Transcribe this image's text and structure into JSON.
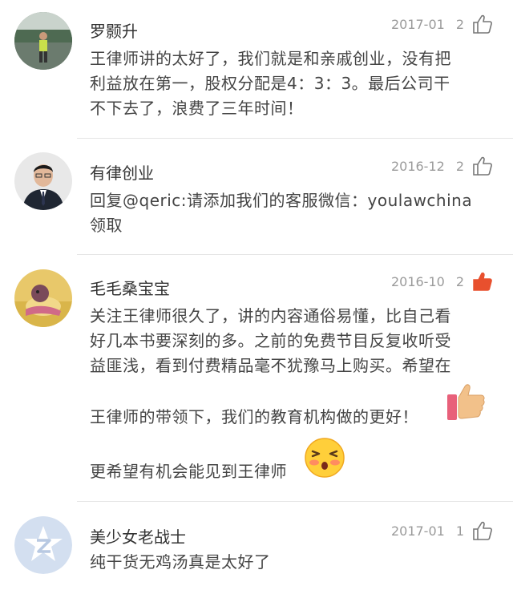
{
  "colors": {
    "liked": "#e8502e",
    "meta": "#9a9a9a",
    "divider": "#e5e5e5"
  },
  "comments": [
    {
      "name": "罗颢升",
      "date": "2017-01",
      "likes": "2",
      "liked": false,
      "avatar": "runner-photo",
      "lines": [
        "王律师讲的太好了，我们就是和亲戚创业，没有把",
        "利益放在第一，股权分配是4：3：3。最后公司干",
        "不下去了，浪费了三年时间！"
      ]
    },
    {
      "name": "有律创业",
      "date": "2016-12",
      "likes": "2",
      "liked": false,
      "avatar": "man-in-suit-photo",
      "lines": [
        "回复@qeric:请添加我们的客服微信：youlawchina",
        "领取"
      ]
    },
    {
      "name": "毛毛桑宝宝",
      "date": "2016-10",
      "likes": "2",
      "liked": true,
      "avatar": "toy-photo",
      "lines": [
        "关注王律师很久了，讲的内容通俗易懂，比自己看",
        "好几本书要深刻的多。之前的免费节目反复收听受",
        "益匪浅，看到付费精品毫不犹豫马上购买。希望在",
        "王律师的带领下，我们的教育机构做的更好！",
        "更希望有机会能见到王律师"
      ],
      "emojis": [
        "thumbs-up-emoji",
        "blushing-face-emoji"
      ]
    },
    {
      "name": "美少女老战士",
      "date": "2017-01",
      "likes": "1",
      "liked": false,
      "avatar": "default-z-avatar",
      "lines": [
        "纯干货无鸡汤真是太好了"
      ]
    }
  ]
}
